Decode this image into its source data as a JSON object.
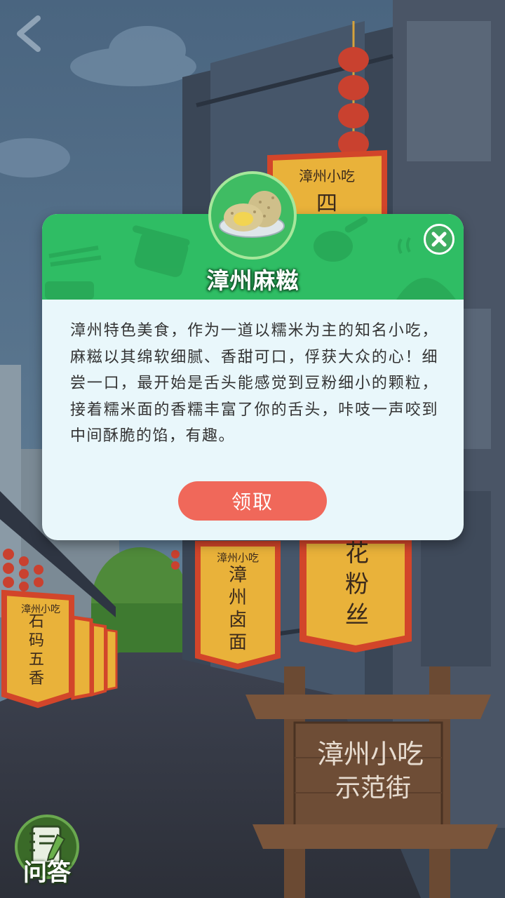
{
  "scene": {
    "banners": {
      "left": {
        "header": "漳州小吃",
        "text": "石码五香"
      },
      "center": {
        "header": "漳州小吃",
        "text": "漳州卤面"
      },
      "right": {
        "text": "花粉丝"
      },
      "top": {
        "header": "漳州小吃",
        "text": "四"
      }
    },
    "signpost": {
      "line1": "漳州小吃",
      "line2": "示范街"
    }
  },
  "dialog": {
    "title": "漳州麻糍",
    "body": "漳州特色美食，作为一道以糯米为主的知名小吃，麻糍以其绵软细腻、香甜可口，俘获大众的心！细尝一口，最开始是舌头能感觉到豆粉细小的颗粒，接着糯米面的香糯丰富了你的舌头，咔吱一声咬到中间酥脆的馅，有趣。",
    "claim_label": "领取",
    "food_icon": "mochi-plate-icon",
    "close_icon": "close-icon"
  },
  "nav": {
    "back_icon": "chevron-left-icon",
    "quiz_label": "问答",
    "quiz_icon": "notebook-pencil-icon"
  },
  "colors": {
    "header_green": "#2fbd64",
    "dialog_bg": "#e9f7fb",
    "claim_button": "#f0685a",
    "banner_yellow": "#e9b23a",
    "banner_red": "#d2452a"
  }
}
